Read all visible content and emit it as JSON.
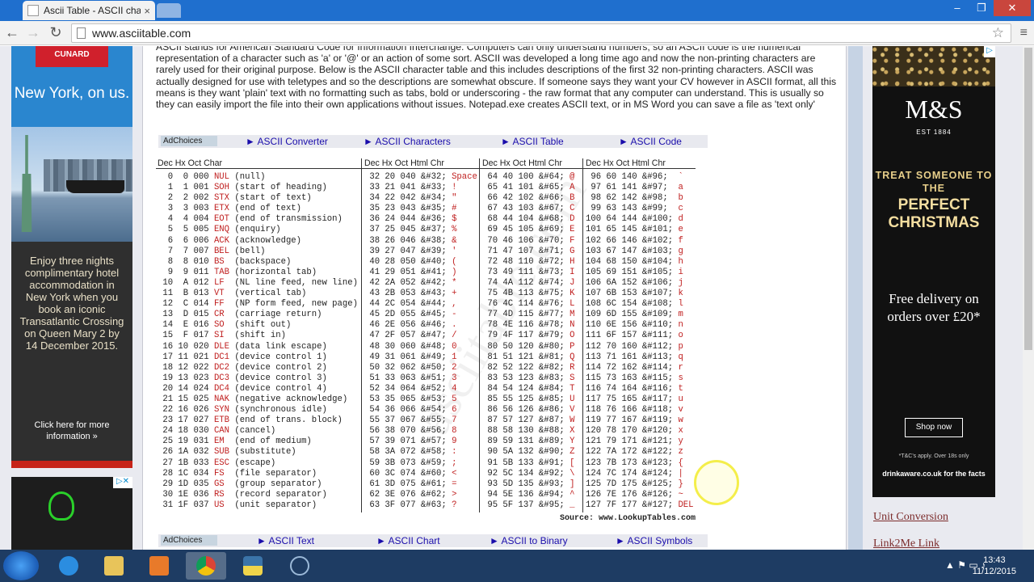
{
  "browser": {
    "tab_title": "Ascii Table - ASCII charact",
    "url": "www.asciitable.com",
    "close_label": "×",
    "back": "←",
    "forward": "→",
    "reload": "↻",
    "star": "☆",
    "menu": "≡",
    "minimize": "–",
    "maximize": "❐",
    "close": "✕"
  },
  "left_ad": {
    "brand": "CUNARD",
    "headline": "New York, on us.",
    "body": "Enjoy three nights complimentary hotel accommodation in New York when you book an iconic Transatlantic Crossing on Queen Mary 2 by 14 December 2015.",
    "cta": "Click here for more information »",
    "ad_marker": "▷✕"
  },
  "intro_text": "ASCII stands for American Standard Code for Information Interchange. Computers can only understand numbers, so an ASCII code is the numerical representation of a character such as 'a' or '@' or an action of some sort. ASCII was developed a long time ago and now the non-printing characters are rarely used for their original purpose. Below is the ASCII character table and this includes descriptions of the first 32 non-printing characters. ASCII was actually designed for use with teletypes and so the descriptions are somewhat obscure. If someone says they want your CV however in ASCII format, all this means is they want 'plain' text with no formatting such as tabs, bold or underscoring - the raw format that any computer can understand. This is usually so they can easily import the file into their own applications without issues. Notepad.exe creates ASCII text, or in MS Word you can save a file as 'text only'",
  "linkbar_top": {
    "adchoices": "AdChoices",
    "links": [
      "► ASCII Converter",
      "► ASCII Characters",
      "► ASCII Table",
      "► ASCII Code"
    ]
  },
  "linkbar_bottom": {
    "adchoices": "AdChoices",
    "links": [
      "► ASCII Text",
      "► ASCII Chart",
      "► ASCII to Binary",
      "► ASCII Symbols"
    ]
  },
  "table": {
    "header1": "Dec  Hx Oct  Char",
    "header2": "Dec  Hx Oct   Html  Chr",
    "header3": "Dec  Hx Oct   Html  Chr",
    "header4": "Dec  Hx Oct   Html  Chr",
    "source": "Source:  www.LookupTables.com",
    "watermark": "asciitable.com",
    "col1": [
      [
        "  0  0 000 ",
        "NUL",
        " (null)"
      ],
      [
        "  1  1 001 ",
        "SOH",
        " (start of heading)"
      ],
      [
        "  2  2 002 ",
        "STX",
        " (start of text)"
      ],
      [
        "  3  3 003 ",
        "ETX",
        " (end of text)"
      ],
      [
        "  4  4 004 ",
        "EOT",
        " (end of transmission)"
      ],
      [
        "  5  5 005 ",
        "ENQ",
        " (enquiry)"
      ],
      [
        "  6  6 006 ",
        "ACK",
        " (acknowledge)"
      ],
      [
        "  7  7 007 ",
        "BEL",
        " (bell)"
      ],
      [
        "  8  8 010 ",
        "BS ",
        " (backspace)"
      ],
      [
        "  9  9 011 ",
        "TAB",
        " (horizontal tab)"
      ],
      [
        " 10  A 012 ",
        "LF ",
        " (NL line feed, new line)"
      ],
      [
        " 11  B 013 ",
        "VT ",
        " (vertical tab)"
      ],
      [
        " 12  C 014 ",
        "FF ",
        " (NP form feed, new page)"
      ],
      [
        " 13  D 015 ",
        "CR ",
        " (carriage return)"
      ],
      [
        " 14  E 016 ",
        "SO ",
        " (shift out)"
      ],
      [
        " 15  F 017 ",
        "SI ",
        " (shift in)"
      ],
      [
        " 16 10 020 ",
        "DLE",
        " (data link escape)"
      ],
      [
        " 17 11 021 ",
        "DC1",
        " (device control 1)"
      ],
      [
        " 18 12 022 ",
        "DC2",
        " (device control 2)"
      ],
      [
        " 19 13 023 ",
        "DC3",
        " (device control 3)"
      ],
      [
        " 20 14 024 ",
        "DC4",
        " (device control 4)"
      ],
      [
        " 21 15 025 ",
        "NAK",
        " (negative acknowledge)"
      ],
      [
        " 22 16 026 ",
        "SYN",
        " (synchronous idle)"
      ],
      [
        " 23 17 027 ",
        "ETB",
        " (end of trans. block)"
      ],
      [
        " 24 18 030 ",
        "CAN",
        " (cancel)"
      ],
      [
        " 25 19 031 ",
        "EM ",
        " (end of medium)"
      ],
      [
        " 26 1A 032 ",
        "SUB",
        " (substitute)"
      ],
      [
        " 27 1B 033 ",
        "ESC",
        " (escape)"
      ],
      [
        " 28 1C 034 ",
        "FS ",
        " (file separator)"
      ],
      [
        " 29 1D 035 ",
        "GS ",
        " (group separator)"
      ],
      [
        " 30 1E 036 ",
        "RS ",
        " (record separator)"
      ],
      [
        " 31 1F 037 ",
        "US ",
        " (unit separator)"
      ]
    ],
    "col2": [
      [
        " 32 20 040 &#32; ",
        "Space"
      ],
      [
        " 33 21 041 &#33; ",
        "!"
      ],
      [
        " 34 22 042 &#34; ",
        "\""
      ],
      [
        " 35 23 043 &#35; ",
        "#"
      ],
      [
        " 36 24 044 &#36; ",
        "$"
      ],
      [
        " 37 25 045 &#37; ",
        "%"
      ],
      [
        " 38 26 046 &#38; ",
        "&"
      ],
      [
        " 39 27 047 &#39; ",
        "'"
      ],
      [
        " 40 28 050 &#40; ",
        "("
      ],
      [
        " 41 29 051 &#41; ",
        ")"
      ],
      [
        " 42 2A 052 &#42; ",
        "*"
      ],
      [
        " 43 2B 053 &#43; ",
        "+"
      ],
      [
        " 44 2C 054 &#44; ",
        ","
      ],
      [
        " 45 2D 055 &#45; ",
        "-"
      ],
      [
        " 46 2E 056 &#46; ",
        "."
      ],
      [
        " 47 2F 057 &#47; ",
        "/"
      ],
      [
        " 48 30 060 &#48; ",
        "0"
      ],
      [
        " 49 31 061 &#49; ",
        "1"
      ],
      [
        " 50 32 062 &#50; ",
        "2"
      ],
      [
        " 51 33 063 &#51; ",
        "3"
      ],
      [
        " 52 34 064 &#52; ",
        "4"
      ],
      [
        " 53 35 065 &#53; ",
        "5"
      ],
      [
        " 54 36 066 &#54; ",
        "6"
      ],
      [
        " 55 37 067 &#55; ",
        "7"
      ],
      [
        " 56 38 070 &#56; ",
        "8"
      ],
      [
        " 57 39 071 &#57; ",
        "9"
      ],
      [
        " 58 3A 072 &#58; ",
        ":"
      ],
      [
        " 59 3B 073 &#59; ",
        ";"
      ],
      [
        " 60 3C 074 &#60; ",
        "<"
      ],
      [
        " 61 3D 075 &#61; ",
        "="
      ],
      [
        " 62 3E 076 &#62; ",
        ">"
      ],
      [
        " 63 3F 077 &#63; ",
        "?"
      ]
    ],
    "col3": [
      [
        " 64 40 100 &#64; ",
        "@"
      ],
      [
        " 65 41 101 &#65; ",
        "A"
      ],
      [
        " 66 42 102 &#66; ",
        "B"
      ],
      [
        " 67 43 103 &#67; ",
        "C"
      ],
      [
        " 68 44 104 &#68; ",
        "D"
      ],
      [
        " 69 45 105 &#69; ",
        "E"
      ],
      [
        " 70 46 106 &#70; ",
        "F"
      ],
      [
        " 71 47 107 &#71; ",
        "G"
      ],
      [
        " 72 48 110 &#72; ",
        "H"
      ],
      [
        " 73 49 111 &#73; ",
        "I"
      ],
      [
        " 74 4A 112 &#74; ",
        "J"
      ],
      [
        " 75 4B 113 &#75; ",
        "K"
      ],
      [
        " 76 4C 114 &#76; ",
        "L"
      ],
      [
        " 77 4D 115 &#77; ",
        "M"
      ],
      [
        " 78 4E 116 &#78; ",
        "N"
      ],
      [
        " 79 4F 117 &#79; ",
        "O"
      ],
      [
        " 80 50 120 &#80; ",
        "P"
      ],
      [
        " 81 51 121 &#81; ",
        "Q"
      ],
      [
        " 82 52 122 &#82; ",
        "R"
      ],
      [
        " 83 53 123 &#83; ",
        "S"
      ],
      [
        " 84 54 124 &#84; ",
        "T"
      ],
      [
        " 85 55 125 &#85; ",
        "U"
      ],
      [
        " 86 56 126 &#86; ",
        "V"
      ],
      [
        " 87 57 127 &#87; ",
        "W"
      ],
      [
        " 88 58 130 &#88; ",
        "X"
      ],
      [
        " 89 59 131 &#89; ",
        "Y"
      ],
      [
        " 90 5A 132 &#90; ",
        "Z"
      ],
      [
        " 91 5B 133 &#91; ",
        "["
      ],
      [
        " 92 5C 134 &#92; ",
        "\\"
      ],
      [
        " 93 5D 135 &#93; ",
        "]"
      ],
      [
        " 94 5E 136 &#94; ",
        "^"
      ],
      [
        " 95 5F 137 &#95; ",
        "_"
      ]
    ],
    "col4": [
      [
        " 96 60 140 &#96;  ",
        "`"
      ],
      [
        " 97 61 141 &#97;  ",
        "a"
      ],
      [
        " 98 62 142 &#98;  ",
        "b"
      ],
      [
        " 99 63 143 &#99;  ",
        "c"
      ],
      [
        "100 64 144 &#100; ",
        "d"
      ],
      [
        "101 65 145 &#101; ",
        "e"
      ],
      [
        "102 66 146 &#102; ",
        "f"
      ],
      [
        "103 67 147 &#103; ",
        "g"
      ],
      [
        "104 68 150 &#104; ",
        "h"
      ],
      [
        "105 69 151 &#105; ",
        "i"
      ],
      [
        "106 6A 152 &#106; ",
        "j"
      ],
      [
        "107 6B 153 &#107; ",
        "k"
      ],
      [
        "108 6C 154 &#108; ",
        "l"
      ],
      [
        "109 6D 155 &#109; ",
        "m"
      ],
      [
        "110 6E 156 &#110; ",
        "n"
      ],
      [
        "111 6F 157 &#111; ",
        "o"
      ],
      [
        "112 70 160 &#112; ",
        "p"
      ],
      [
        "113 71 161 &#113; ",
        "q"
      ],
      [
        "114 72 162 &#114; ",
        "r"
      ],
      [
        "115 73 163 &#115; ",
        "s"
      ],
      [
        "116 74 164 &#116; ",
        "t"
      ],
      [
        "117 75 165 &#117; ",
        "u"
      ],
      [
        "118 76 166 &#118; ",
        "v"
      ],
      [
        "119 77 167 &#119; ",
        "w"
      ],
      [
        "120 78 170 &#120; ",
        "x"
      ],
      [
        "121 79 171 &#121; ",
        "y"
      ],
      [
        "122 7A 172 &#122; ",
        "z"
      ],
      [
        "123 7B 173 &#123; ",
        "{"
      ],
      [
        "124 7C 174 &#124; ",
        "|"
      ],
      [
        "125 7D 175 &#125; ",
        "}"
      ],
      [
        "126 7E 176 &#126; ",
        "~"
      ],
      [
        "127 7F 177 &#127; ",
        "DEL"
      ]
    ]
  },
  "right_ad": {
    "brand": "M&S",
    "est": "EST 1884",
    "line1": "TREAT SOMEONE TO THE",
    "line2": "PERFECT CHRISTMAS",
    "offer": "Free delivery on orders over £20*",
    "cta": "Shop now",
    "terms": "*T&C's apply. Over 18s only",
    "drinkaware": "drinkaware.co.uk for the facts",
    "ad_marker": "▷"
  },
  "right_links": [
    "Unit Conversion",
    "Link2Me Link"
  ],
  "taskbar": {
    "time": "13:43",
    "date": "11/12/2015",
    "tray": "▲ ⚑ ▭ ♪"
  },
  "colors": {
    "accent_red": "#c02020",
    "link_blue": "#1a0dab",
    "chrome_blue": "#1f6fce"
  }
}
